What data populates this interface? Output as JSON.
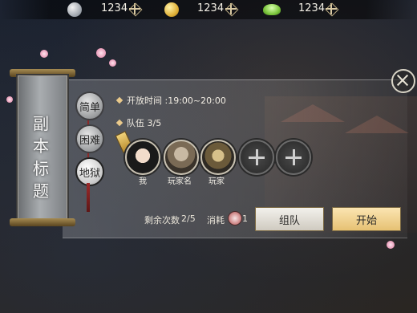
{
  "currency": {
    "silver": {
      "icon": "silver-coin-icon",
      "amount": "1234"
    },
    "gold": {
      "icon": "gold-coin-icon",
      "amount": "1234"
    },
    "ingot": {
      "icon": "jade-ingot-icon",
      "amount": "1234"
    }
  },
  "dungeon": {
    "title": "副本标题",
    "tabs": [
      "简单",
      "困难",
      "地狱"
    ],
    "active_tab": "地狱",
    "open_time": "开放时间 :19:00~20:00",
    "team": "队伍 3/5"
  },
  "players": [
    {
      "name": "我",
      "filled": true
    },
    {
      "name": "玩家名",
      "filled": true
    },
    {
      "name": "玩家",
      "filled": true
    },
    {
      "name": "",
      "filled": false
    },
    {
      "name": "",
      "filled": false
    }
  ],
  "footer": {
    "remaining_label": "剩余次数",
    "remaining_value": "2/5",
    "cost_label": "消耗",
    "cost_value": "1",
    "team_button": "组队",
    "start_button": "开始"
  }
}
